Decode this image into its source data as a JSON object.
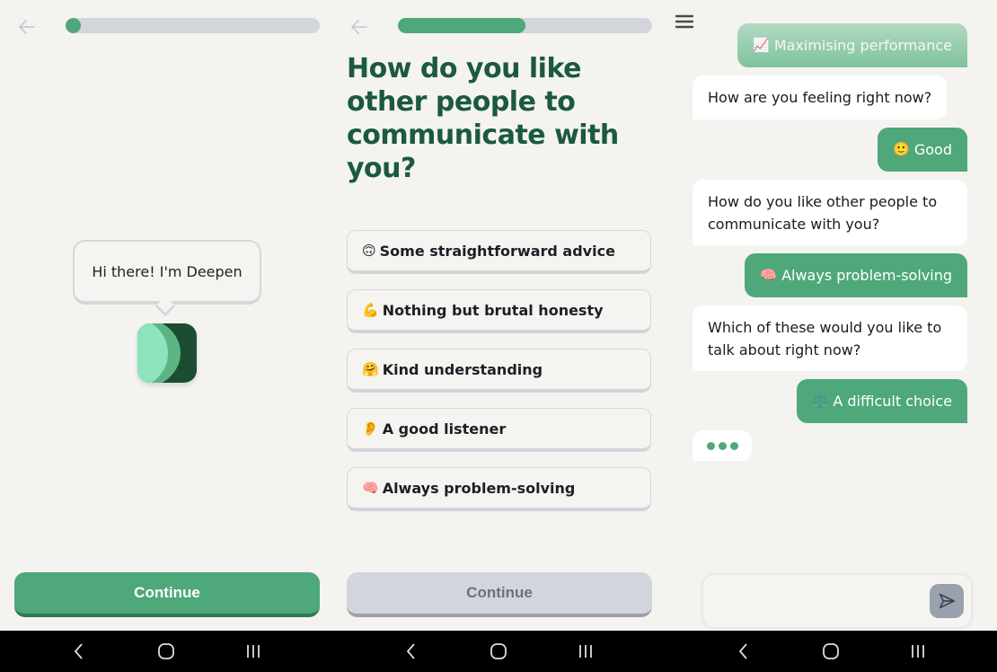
{
  "screens": {
    "intro": {
      "progress_fraction": 0.06,
      "greeting": "Hi there! I'm Deepen",
      "continue_label": "Continue"
    },
    "question": {
      "progress_fraction": 0.5,
      "title": "How do you like other people to communicate with you?",
      "options": [
        {
          "emoji": "🙃",
          "label": "Some straightforward advice"
        },
        {
          "emoji": "💪",
          "label": "Nothing but brutal honesty"
        },
        {
          "emoji": "🤗",
          "label": "Kind understanding"
        },
        {
          "emoji": "👂",
          "label": "A good listener"
        },
        {
          "emoji": "🧠",
          "label": "Always problem-solving"
        }
      ],
      "continue_label": "Continue"
    },
    "chat": {
      "messages": [
        {
          "role": "user",
          "emoji": "📈",
          "text": "Maximising performance"
        },
        {
          "role": "bot",
          "text": "How are you feeling right now?"
        },
        {
          "role": "user",
          "emoji": "🙂",
          "text": "Good"
        },
        {
          "role": "bot",
          "text": "How do you like other people to communicate with you?"
        },
        {
          "role": "user",
          "emoji": "🧠",
          "text": "Always problem-solving"
        },
        {
          "role": "bot",
          "text": "Which of these would you like to talk about right now?"
        },
        {
          "role": "user",
          "emoji": "⚖️",
          "text": "A difficult choice"
        }
      ],
      "input_value": "",
      "input_placeholder": ""
    }
  },
  "colors": {
    "brand_green": "#4ea87a",
    "heading_green": "#1b5a3c",
    "disabled_gray": "#d2d5dc"
  },
  "icons": {
    "back": "arrow-left",
    "menu": "hamburger",
    "send": "paper-plane",
    "nav_back": "chevron-left",
    "nav_home": "rounded-square",
    "nav_recents": "three-bars"
  }
}
